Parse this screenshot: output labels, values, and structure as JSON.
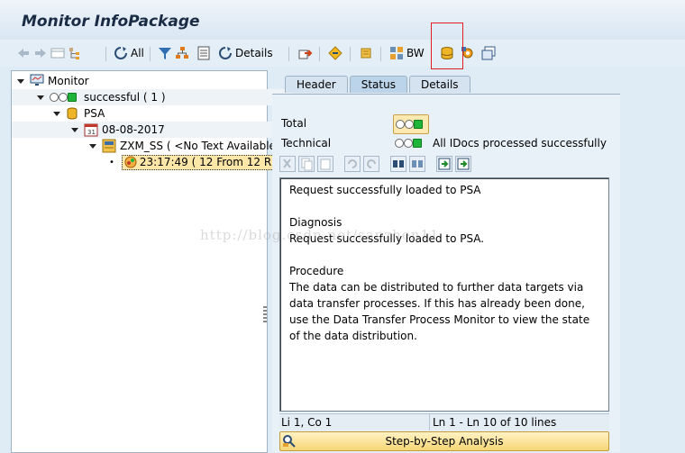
{
  "window": {
    "title": "Monitor InfoPackage"
  },
  "toolbar": {
    "all_label": "All",
    "details_label": "Details",
    "bw_label": "BW",
    "icons": [
      "back-icon",
      "forward-icon",
      "layout-icon",
      "tree-icon",
      "refresh-all-icon",
      "filter-icon",
      "hierarchy-icon",
      "list-icon",
      "details-icon",
      "export-icon",
      "navigate-icon",
      "scroll-icon",
      "bw-icon",
      "database-icon",
      "settings-icon",
      "copy-window-icon"
    ]
  },
  "tree": {
    "nodes": [
      {
        "label": "Monitor"
      },
      {
        "label": "successful ( 1 )"
      },
      {
        "label": "PSA"
      },
      {
        "label": "08-08-2017"
      },
      {
        "label": "ZXM_SS ( <No Text Available"
      },
      {
        "label": "23:17:49 ( 12 From 12 R"
      }
    ]
  },
  "tabs": [
    {
      "label": "Header"
    },
    {
      "label": "Status"
    },
    {
      "label": "Details"
    }
  ],
  "status_panel": {
    "total_label": "Total",
    "technical_label": "Technical",
    "technical_text": "All IDocs processed successfully"
  },
  "message": {
    "line1": "Request successfully loaded to PSA",
    "diagnosis_heading": "Diagnosis",
    "diagnosis_text": "Request successfully loaded to PSA.",
    "procedure_heading": "Procedure",
    "procedure_text": "The data can be distributed to further data targets via data transfer processes. If this has already been done, use the Data Transfer Process Monitor to view the state of the data distribution."
  },
  "editor_status": {
    "cursor": "Li 1, Co 1",
    "lines": "Ln 1 - Ln 10 of 10 lines"
  },
  "step_button": {
    "label": "Step-by-Step Analysis"
  },
  "watermark": "http://blog.csdn.net/sapzhen11",
  "colors": {
    "accent": "#fde7a8",
    "highlight_border": "#e02020",
    "green_light": "#1fb53a"
  }
}
